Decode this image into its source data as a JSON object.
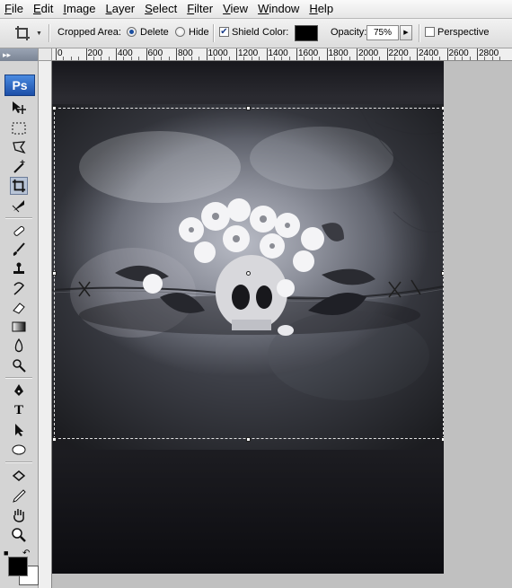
{
  "menu": [
    "File",
    "Edit",
    "Image",
    "Layer",
    "Select",
    "Filter",
    "View",
    "Window",
    "Help"
  ],
  "options": {
    "tool_icon": "crop-icon",
    "cropped_area_label": "Cropped Area:",
    "delete_label": "Delete",
    "hide_label": "Hide",
    "shield_label": "Shield",
    "color_label": "Color:",
    "shield_color": "#000000",
    "opacity_label": "Opacity:",
    "opacity_value": "75%",
    "perspective_label": "Perspective",
    "delete_selected": true,
    "shield_checked": true,
    "perspective_checked": false
  },
  "toolbox": {
    "logo": "Ps",
    "text_tool": "T",
    "tools": [
      "move-icon",
      "marquee-icon",
      "lasso-icon",
      "magic-wand-icon",
      "crop-icon",
      "slice-icon",
      "healing-brush-icon",
      "brush-icon",
      "clone-stamp-icon",
      "history-brush-icon",
      "eraser-icon",
      "gradient-icon",
      "blur-icon",
      "dodge-icon",
      "pen-icon",
      "type-icon",
      "path-selection-icon",
      "ellipse-icon",
      "3d-rotate-icon",
      "eyedropper-icon",
      "hand-icon",
      "zoom-icon"
    ],
    "foreground_color": "#000000",
    "background_color": "#ffffff"
  },
  "ruler": {
    "labels": [
      "0",
      "200",
      "400",
      "600",
      "800",
      "1000",
      "1200",
      "1400",
      "1600",
      "1800",
      "2000",
      "2200",
      "2400",
      "2600",
      "2800"
    ]
  }
}
